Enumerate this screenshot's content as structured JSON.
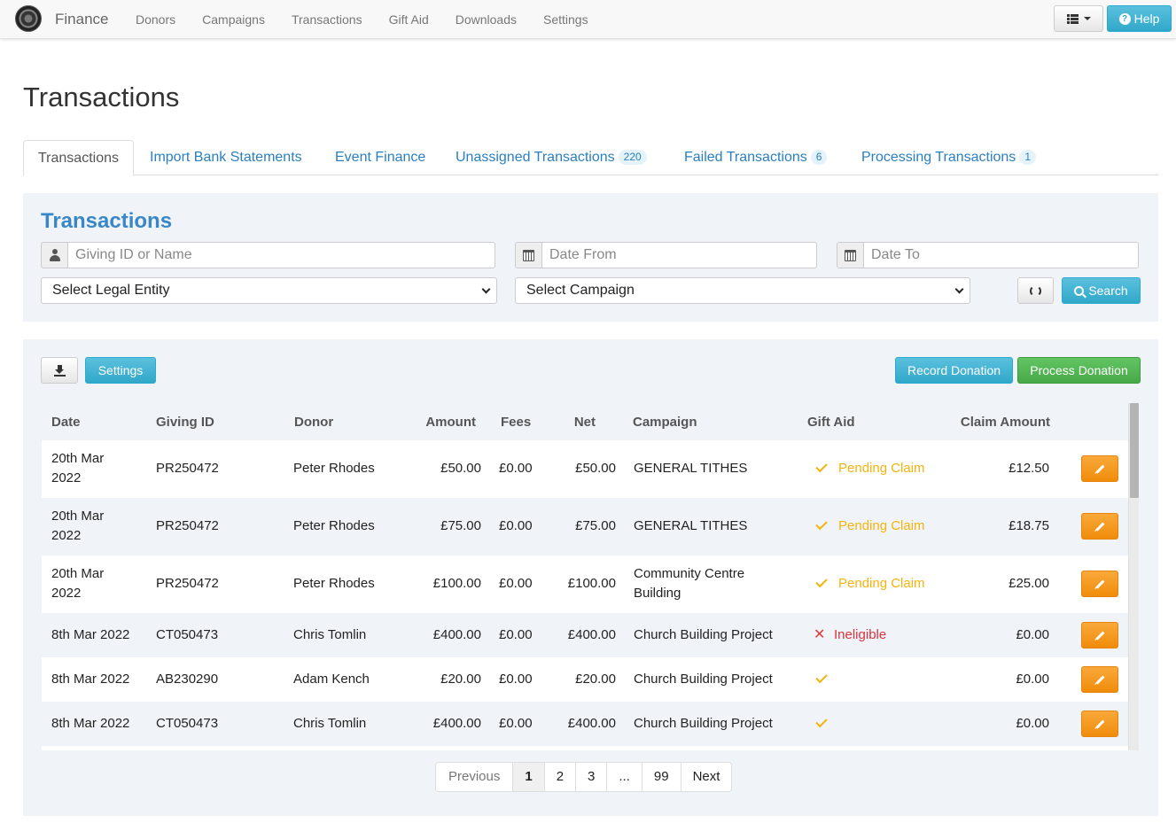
{
  "navbar": {
    "brand": "Finance",
    "links": [
      "Donors",
      "Campaigns",
      "Transactions",
      "Gift Aid",
      "Downloads",
      "Settings"
    ],
    "help_label": "Help"
  },
  "page": {
    "title": "Transactions"
  },
  "tabs": [
    {
      "label": "Transactions",
      "active": true
    },
    {
      "label": "Import Bank Statements"
    },
    {
      "label": "Event Finance"
    },
    {
      "label": "Unassigned Transactions",
      "badge": "220"
    },
    {
      "label": "Failed Transactions",
      "badge": "6"
    },
    {
      "label": "Processing Transactions",
      "badge": "1"
    }
  ],
  "filters": {
    "title": "Transactions",
    "giving_placeholder": "Giving ID or Name",
    "date_from_placeholder": "Date From",
    "date_to_placeholder": "Date To",
    "legal_entity": "Select Legal Entity",
    "campaign": "Select Campaign",
    "search_label": "Search"
  },
  "toolbar": {
    "settings_label": "Settings",
    "record_label": "Record Donation",
    "process_label": "Process Donation"
  },
  "table": {
    "headers": [
      "Date",
      "Giving ID",
      "Donor",
      "Amount",
      "Fees",
      "Net",
      "Campaign",
      "Gift Aid",
      "Claim Amount"
    ],
    "rows": [
      {
        "date": "20th Mar 2022",
        "giving_id": "PR250472",
        "donor": "Peter Rhodes",
        "amount": "£50.00",
        "fees": "£0.00",
        "net": "£50.00",
        "campaign": "GENERAL TITHES",
        "gift_aid_icon": "check-icon",
        "gift_aid": "Pending Claim",
        "claim": "£12.50"
      },
      {
        "date": "20th Mar 2022",
        "giving_id": "PR250472",
        "donor": "Peter Rhodes",
        "amount": "£75.00",
        "fees": "£0.00",
        "net": "£75.00",
        "campaign": "GENERAL TITHES",
        "gift_aid_icon": "check-icon",
        "gift_aid": "Pending Claim",
        "claim": "£18.75"
      },
      {
        "date": "20th Mar 2022",
        "giving_id": "PR250472",
        "donor": "Peter Rhodes",
        "amount": "£100.00",
        "fees": "£0.00",
        "net": "£100.00",
        "campaign": "Community Centre Building",
        "gift_aid_icon": "check-icon",
        "gift_aid": "Pending Claim",
        "claim": "£25.00"
      },
      {
        "date": "8th Mar 2022",
        "giving_id": "CT050473",
        "donor": "Chris Tomlin",
        "amount": "£400.00",
        "fees": "£0.00",
        "net": "£400.00",
        "campaign": "Church Building Project",
        "gift_aid_icon": "x-icon",
        "gift_aid": "Ineligible",
        "claim": "£0.00"
      },
      {
        "date": "8th Mar 2022",
        "giving_id": "AB230290",
        "donor": "Adam Kench",
        "amount": "£20.00",
        "fees": "£0.00",
        "net": "£20.00",
        "campaign": "Church Building Project",
        "gift_aid_icon": "check-icon",
        "gift_aid": "",
        "claim": "£0.00"
      },
      {
        "date": "8th Mar 2022",
        "giving_id": "CT050473",
        "donor": "Chris Tomlin",
        "amount": "£400.00",
        "fees": "£0.00",
        "net": "£400.00",
        "campaign": "Church Building Project",
        "gift_aid_icon": "check-icon",
        "gift_aid": "",
        "claim": "£0.00"
      }
    ]
  },
  "pagination": {
    "items": [
      "Previous",
      "1",
      "2",
      "3",
      "...",
      "99",
      "Next"
    ],
    "current": "1"
  },
  "colors": {
    "primary_link": "#2a7fc0",
    "info": "#5bc0de",
    "success": "#5cb85c",
    "warning": "#f0ad4e",
    "danger": "#d9323c"
  }
}
